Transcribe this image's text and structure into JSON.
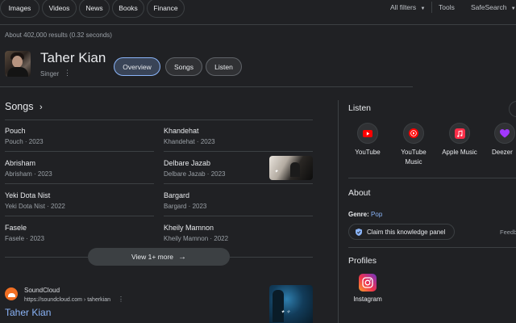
{
  "filters": {
    "chips": [
      "Images",
      "Videos",
      "News",
      "Books",
      "Finance"
    ],
    "all_filters": "All filters",
    "tools": "Tools",
    "safesearch": "SafeSearch"
  },
  "results_count": "About 402,000 results (0.32 seconds)",
  "entity": {
    "name": "Taher Kian",
    "type": "Singer",
    "tabs": [
      "Overview",
      "Songs",
      "Listen"
    ],
    "active_tab": "Overview"
  },
  "songs": {
    "title": "Songs",
    "left": [
      {
        "title": "Pouch",
        "sub": "Pouch · 2023"
      },
      {
        "title": "Abrisham",
        "sub": "Abrisham · 2023"
      },
      {
        "title": "Yeki Dota Nist",
        "sub": "Yeki Dota Nist · 2022"
      },
      {
        "title": "Fasele",
        "sub": "Fasele · 2023"
      }
    ],
    "right": [
      {
        "title": "Khandehat",
        "sub": "Khandehat · 2023"
      },
      {
        "title": "Delbare Jazab",
        "sub": "Delbare Jazab · 2023"
      },
      {
        "title": "Bargard",
        "sub": "Bargard · 2023"
      },
      {
        "title": "Kheily Mamnon",
        "sub": "Kheily Mamnon · 2022"
      }
    ],
    "view_more": "View 1+ more"
  },
  "result": {
    "site_name": "SoundCloud",
    "url": "https://soundcloud.com › taherkian",
    "link_title": "Taher Kian"
  },
  "listen": {
    "title": "Listen",
    "services": [
      {
        "name": "YouTube",
        "label": "YouTube",
        "icon": "youtube-icon",
        "color": "#ff0000"
      },
      {
        "name": "YouTube Music",
        "label": "YouTube Music",
        "icon": "youtube-music-icon",
        "color": "#ff0000"
      },
      {
        "name": "Apple Music",
        "label": "Apple Music",
        "icon": "apple-music-icon",
        "color": "#fa2d48"
      },
      {
        "name": "Deezer",
        "label": "Deezer",
        "icon": "deezer-icon",
        "color": "#a238ff"
      }
    ]
  },
  "about": {
    "title": "About",
    "genre_label": "Genre:",
    "genre_value": "Pop",
    "claim": "Claim this knowledge panel",
    "feedback": "Feedb"
  },
  "profiles": {
    "title": "Profiles",
    "items": [
      {
        "label": "Instagram",
        "icon": "instagram-icon"
      }
    ]
  },
  "colors": {
    "background": "#202124",
    "link": "#8ab4f8",
    "muted": "#9aa0a6"
  }
}
